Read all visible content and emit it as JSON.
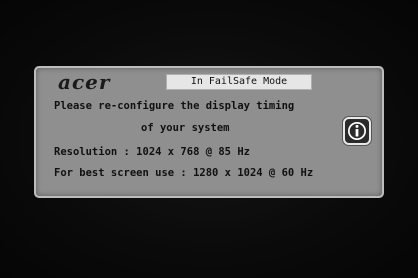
{
  "osd": {
    "brand": "acer",
    "mode_title": "In FailSafe Mode",
    "message_line1": "Please re-configure the display timing",
    "message_line2": "of your system",
    "resolution_text": "Resolution : 1024 x 768 @ 85 Hz",
    "best_use_text": "For best screen use : 1280 x 1024 @ 60 Hz",
    "icon": "info-icon"
  },
  "colors": {
    "panel_bg": "#8f8f8f",
    "panel_border": "#bdbdbd",
    "banner_bg": "#e6e6e6",
    "text": "#111111",
    "screen_bg": "#0d0d0d"
  }
}
